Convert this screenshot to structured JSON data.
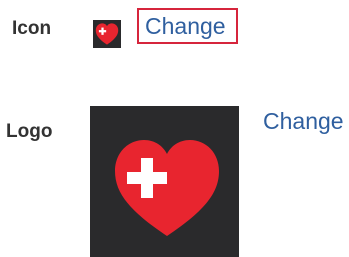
{
  "icon_row": {
    "label": "Icon",
    "change_label": "Change",
    "image_icon": "heart-plus-icon"
  },
  "logo_row": {
    "label": "Logo",
    "change_label": "Change",
    "image_icon": "heart-plus-icon"
  },
  "colors": {
    "heart": "#e8252f",
    "thumb_background": "#2a2a2c",
    "link": "#2f5f9f",
    "focus_outline": "#d6253c"
  }
}
